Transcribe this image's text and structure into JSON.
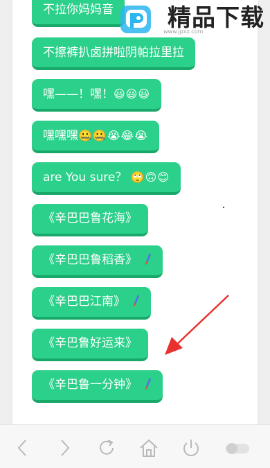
{
  "items": [
    {
      "text": "不拉你妈妈音",
      "suffix": "",
      "rocket": false
    },
    {
      "text": "不擦裤扒卤拼啦阴帕拉里拉",
      "suffix": "",
      "rocket": false
    },
    {
      "text": "嘿——！嘿！",
      "suffix": "😃😃😃",
      "rocket": false
    },
    {
      "text": "嘿嘿嘿",
      "suffix": "🤐🤐😭😂😭",
      "rocket": false
    },
    {
      "text": "are You sure？",
      "suffix": "🙄🙃😊",
      "rocket": false
    },
    {
      "text": "《辛巴巴鲁花海》",
      "suffix": "",
      "rocket": false
    },
    {
      "text": "《辛巴巴鲁稻香》",
      "suffix": "",
      "rocket": true
    },
    {
      "text": "《辛巴巴江南》",
      "suffix": "",
      "rocket": true
    },
    {
      "text": "《辛巴鲁好运来》",
      "suffix": "",
      "rocket": false
    },
    {
      "text": "《辛巴鲁一分钟》",
      "suffix": "",
      "rocket": true
    }
  ],
  "watermark": {
    "title": "精品下载",
    "url": "www.jpxz.com"
  },
  "toolbar": {
    "icons": [
      "back-icon",
      "forward-icon",
      "refresh-icon",
      "home-icon",
      "power-icon",
      "toggle-switch"
    ]
  },
  "colors": {
    "chip": "#2bd08a",
    "chip_shadow": "#17a86a",
    "arrow": "#e8322e"
  }
}
